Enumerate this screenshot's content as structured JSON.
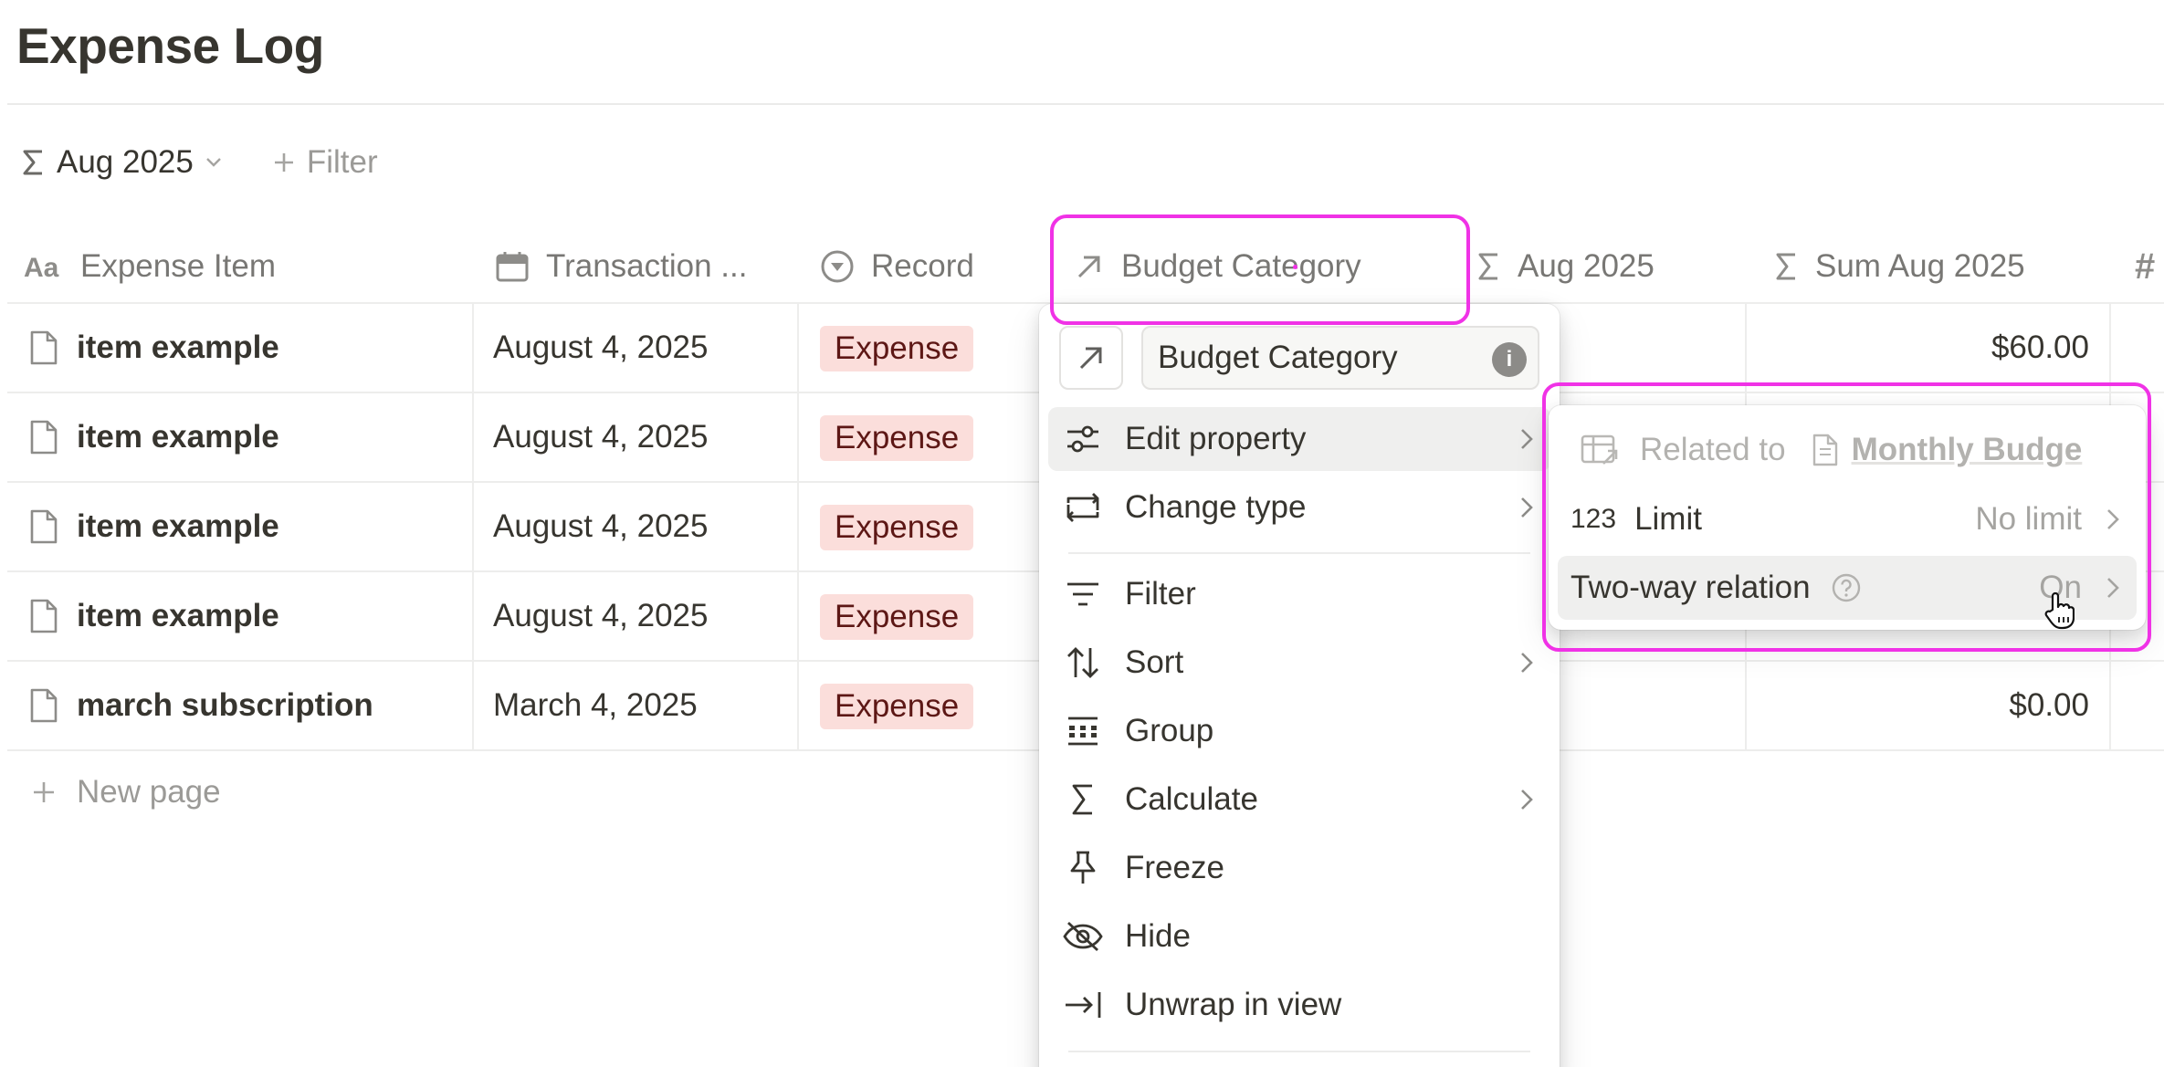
{
  "page": {
    "title": "Expense Log"
  },
  "view_bar": {
    "calc_label": "Aug 2025",
    "filter_label": "Filter"
  },
  "columns": [
    {
      "label": "Expense Item",
      "icon": "text-aa-icon"
    },
    {
      "label": "Transaction ...",
      "icon": "calendar-icon"
    },
    {
      "label": "Record",
      "icon": "select-icon"
    },
    {
      "label": "Budget Category",
      "icon": "relation-arrow-icon"
    },
    {
      "label": "Aug 2025",
      "icon": "sigma-icon"
    },
    {
      "label": "Sum Aug 2025",
      "icon": "sigma-icon"
    },
    {
      "label": "#",
      "icon": "number-icon"
    }
  ],
  "rows": [
    {
      "name": "item example",
      "date": "August 4, 2025",
      "record": "Expense",
      "sum": "$60.00"
    },
    {
      "name": "item example",
      "date": "August 4, 2025",
      "record": "Expense",
      "sum": ""
    },
    {
      "name": "item example",
      "date": "August 4, 2025",
      "record": "Expense",
      "sum": ""
    },
    {
      "name": "item example",
      "date": "August 4, 2025",
      "record": "Expense",
      "sum": ""
    },
    {
      "name": "march subscription",
      "date": "March 4, 2025",
      "record": "Expense",
      "sum": "$0.00"
    }
  ],
  "new_page_label": "New page",
  "property_menu": {
    "name": "Budget Category",
    "info_glyph": "i",
    "items": [
      {
        "label": "Edit property",
        "icon": "sliders-icon",
        "submenu": true,
        "active": true
      },
      {
        "label": "Change type",
        "icon": "change-type-icon",
        "submenu": true
      },
      {
        "label": "Filter",
        "icon": "filter-icon",
        "submenu": false
      },
      {
        "label": "Sort",
        "icon": "sort-icon",
        "submenu": true
      },
      {
        "label": "Group",
        "icon": "group-icon",
        "submenu": false
      },
      {
        "label": "Calculate",
        "icon": "sigma-icon",
        "submenu": true
      },
      {
        "label": "Freeze",
        "icon": "pin-icon",
        "submenu": false
      },
      {
        "label": "Hide",
        "icon": "eye-off-icon",
        "submenu": false
      },
      {
        "label": "Unwrap in view",
        "icon": "unwrap-icon",
        "submenu": false
      }
    ]
  },
  "relation_submenu": {
    "related_to_label": "Related to",
    "related_db": "Monthly Budge",
    "limit_icon_text": "123",
    "limit_label": "Limit",
    "limit_value": "No limit",
    "two_way_label": "Two-way relation",
    "two_way_value": "On"
  },
  "colors": {
    "highlight": "#f032e6",
    "tag_bg": "#fbdedb",
    "tag_text": "#5d1715",
    "text": "#37352f",
    "muted": "#9b9a97"
  }
}
